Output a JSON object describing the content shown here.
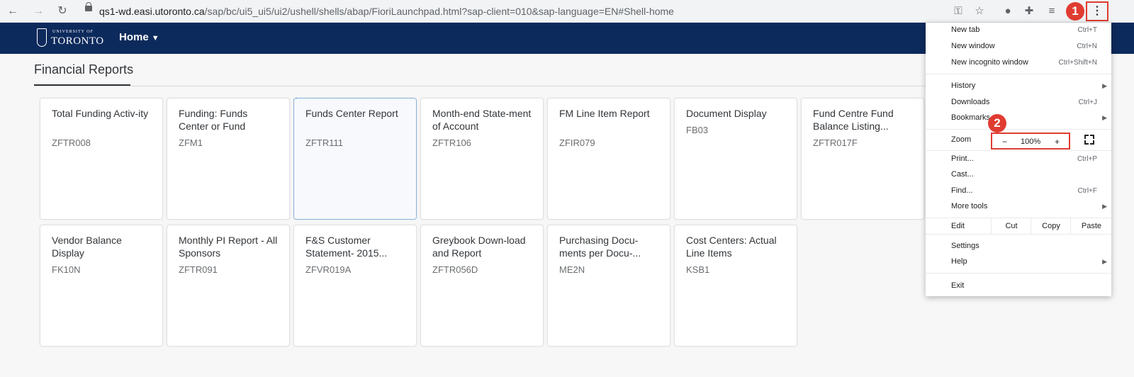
{
  "browser": {
    "back_icon": "arrow-left-icon",
    "forward_icon": "arrow-right-icon",
    "reload_icon": "reload-icon",
    "url_host": "qs1-wd.easi.utoronto.ca",
    "url_path": "/sap/bc/ui5_ui5/ui2/ushell/shells/abap/FioriLaunchpad.html?sap-client=010&sap-language=EN#Shell-home",
    "toolbar_icons": [
      "key-icon",
      "star-icon",
      "extension-circle-icon",
      "puzzle-icon",
      "reading-list-icon"
    ],
    "menu_glyph": "⋮"
  },
  "annotations": {
    "step1": "1",
    "step2": "2",
    "color": "#e03c31"
  },
  "shell": {
    "logo_small": "UNIVERSITY OF",
    "logo_big": "TORONTO",
    "home_label": "Home",
    "header_color": "#0d2a5c"
  },
  "page": {
    "title": "Financial Reports"
  },
  "tiles": [
    {
      "title": "Total Funding Activ-ity",
      "subtitle": "ZFTR008"
    },
    {
      "title": "Funding: Funds Center or Fund",
      "subtitle": "ZFM1"
    },
    {
      "title": "Funds Center Report",
      "subtitle": "ZFTR111"
    },
    {
      "title": "Month-end State-ment of Account",
      "subtitle": "ZFTR106"
    },
    {
      "title": "FM Line Item Report",
      "subtitle": "ZFIR079"
    },
    {
      "title": "Document Display",
      "subtitle": "FB03"
    },
    {
      "title": "Fund Centre Fund Balance Listing...",
      "subtitle": "ZFTR017F"
    },
    {
      "title": "Vendor Balance Display",
      "subtitle": "FK10N"
    },
    {
      "title": "Monthly PI Report - All Sponsors",
      "subtitle": "ZFTR091"
    },
    {
      "title": "F&S Customer Statement- 2015...",
      "subtitle": "ZFVR019A"
    },
    {
      "title": "Greybook Down-load and Report",
      "subtitle": "ZFTR056D"
    },
    {
      "title": "Purchasing Docu-ments per Docu-...",
      "subtitle": "ME2N"
    },
    {
      "title": "Cost Centers: Actual Line Items",
      "subtitle": "KSB1"
    }
  ],
  "chrome_menu": {
    "new_tab": {
      "label": "New tab",
      "shortcut": "Ctrl+T"
    },
    "new_window": {
      "label": "New window",
      "shortcut": "Ctrl+N"
    },
    "new_incognito": {
      "label": "New incognito window",
      "shortcut": "Ctrl+Shift+N"
    },
    "history": {
      "label": "History"
    },
    "downloads": {
      "label": "Downloads",
      "shortcut": "Ctrl+J"
    },
    "bookmarks": {
      "label": "Bookmarks"
    },
    "zoom": {
      "label": "Zoom",
      "minus": "−",
      "value": "100%",
      "plus": "+"
    },
    "print": {
      "label": "Print...",
      "shortcut": "Ctrl+P"
    },
    "cast": {
      "label": "Cast..."
    },
    "find": {
      "label": "Find...",
      "shortcut": "Ctrl+F"
    },
    "more_tools": {
      "label": "More tools"
    },
    "edit": {
      "label": "Edit",
      "cut": "Cut",
      "copy": "Copy",
      "paste": "Paste"
    },
    "settings": {
      "label": "Settings"
    },
    "help": {
      "label": "Help"
    },
    "exit": {
      "label": "Exit"
    }
  }
}
